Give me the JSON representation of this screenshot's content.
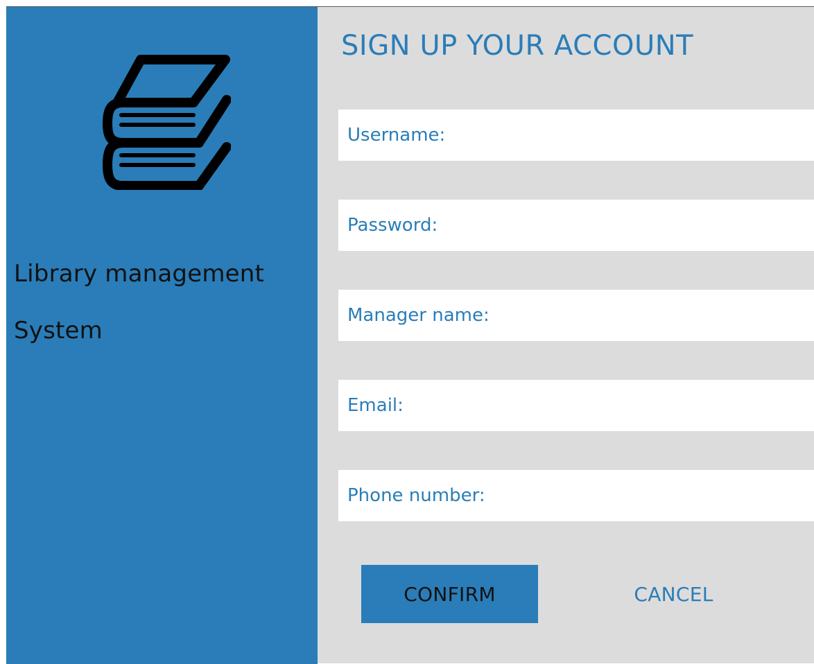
{
  "sidebar": {
    "logo_icon": "books-stack-icon",
    "title_line1": "Library management",
    "title_line2": "System"
  },
  "form": {
    "heading": "SIGN UP YOUR ACCOUNT",
    "fields": [
      {
        "name": "username",
        "placeholder": "Username:",
        "value": ""
      },
      {
        "name": "password",
        "placeholder": "Password:",
        "value": ""
      },
      {
        "name": "manager-name",
        "placeholder": "Manager name:",
        "value": ""
      },
      {
        "name": "email",
        "placeholder": "Email:",
        "value": ""
      },
      {
        "name": "phone-number",
        "placeholder": "Phone number:",
        "value": ""
      }
    ],
    "confirm_label": "CONFIRM",
    "cancel_label": "CANCEL"
  },
  "colors": {
    "accent": "#2a7db8",
    "panel_background": "#dcdcdc",
    "field_background": "#ffffff",
    "text_dark": "#111111"
  }
}
